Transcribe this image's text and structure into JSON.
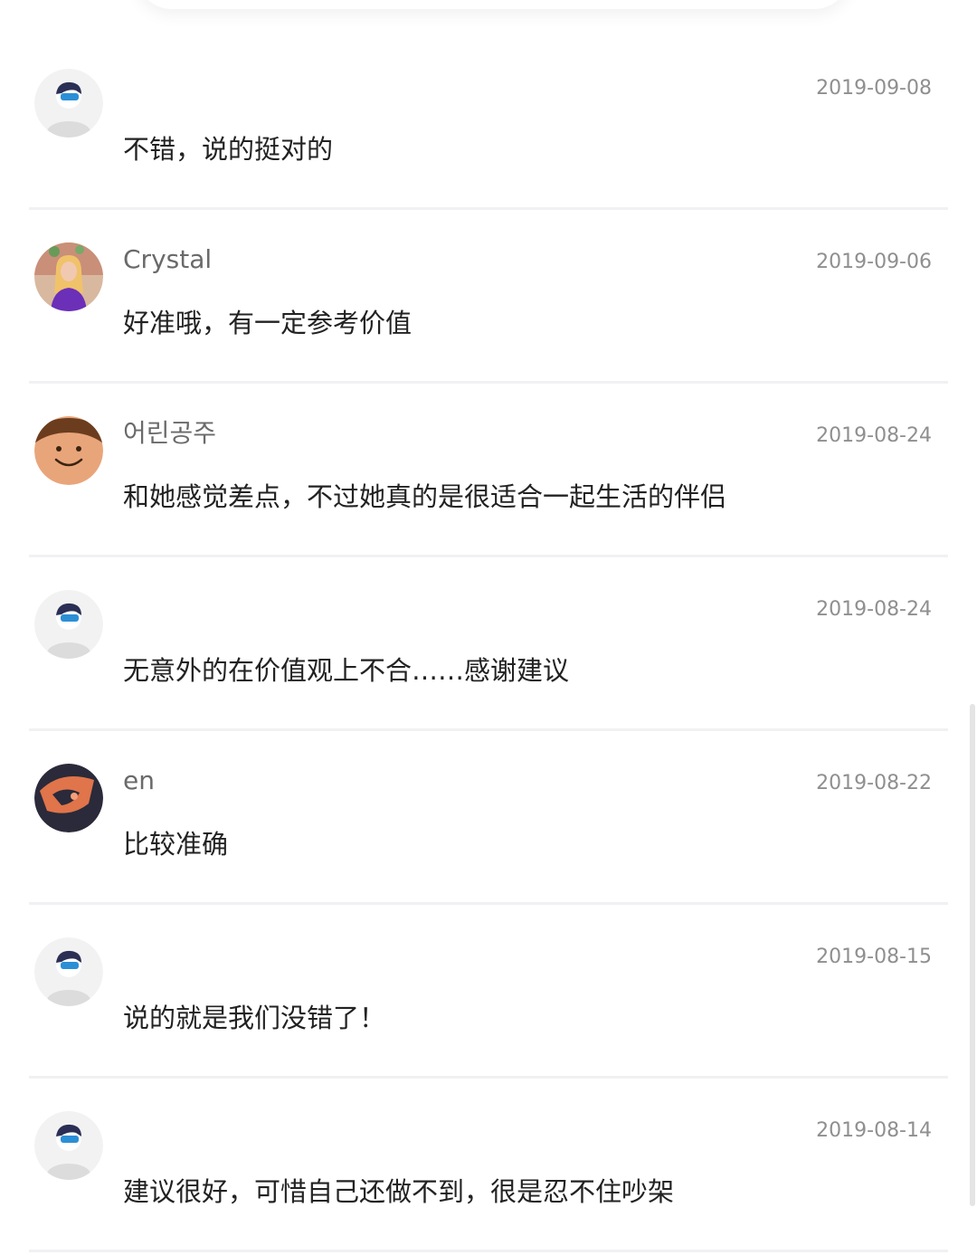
{
  "comments": [
    {
      "username": "",
      "date": "2019-09-08",
      "text": "不错，说的挺对的",
      "avatar": "default-avatar-icon"
    },
    {
      "username": "Crystal",
      "date": "2019-09-06",
      "text": "好准哦，有一定参考价值",
      "avatar": "photo-avatar-woman"
    },
    {
      "username": "어린공주",
      "date": "2019-08-24",
      "text": "和她感觉差点，不过她真的是很适合一起生活的伴侣",
      "avatar": "smiley-face-avatar"
    },
    {
      "username": "",
      "date": "2019-08-24",
      "text": "无意外的在价值观上不合……感谢建议",
      "avatar": "default-avatar-icon"
    },
    {
      "username": "en",
      "date": "2019-08-22",
      "text": "比较准确",
      "avatar": "art-avatar"
    },
    {
      "username": "",
      "date": "2019-08-15",
      "text": "说的就是我们没错了！",
      "avatar": "default-avatar-icon"
    },
    {
      "username": "",
      "date": "2019-08-14",
      "text": "建议很好，可惜自己还做不到，很是忍不住吵架",
      "avatar": "default-avatar-icon"
    }
  ],
  "colors": {
    "text_primary": "#222222",
    "text_secondary": "#6a6a6a",
    "date": "#8f8f8f",
    "divider": "#f1f1f3",
    "default_avatar_accent": "#2c8fd6"
  }
}
